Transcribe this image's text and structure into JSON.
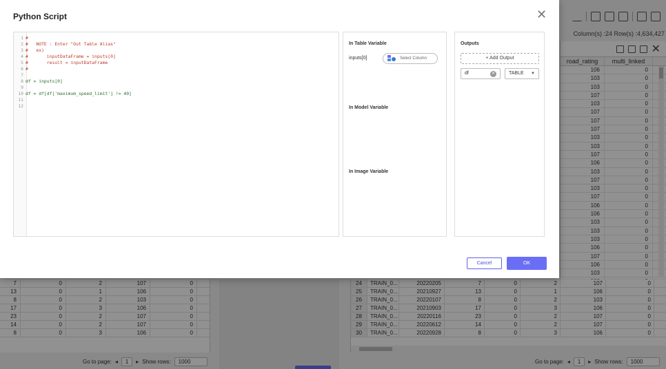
{
  "modal": {
    "title": "Python Script",
    "close_glyph": "✕",
    "code_lines": [
      {
        "n": "1",
        "text": "#",
        "kind": "comment"
      },
      {
        "n": "2",
        "text": "#   NOTE : Enter \"Out Table Alias\"",
        "kind": "comment"
      },
      {
        "n": "3",
        "text": "#   ex)",
        "kind": "comment"
      },
      {
        "n": "4",
        "text": "#       inputDataFrame = inputs[0]",
        "kind": "comment"
      },
      {
        "n": "5",
        "text": "#       result = inputDataFrame",
        "kind": "comment"
      },
      {
        "n": "6",
        "text": "#",
        "kind": "comment"
      },
      {
        "n": "7",
        "text": "",
        "kind": "plain"
      },
      {
        "n": "8",
        "text": "df = inputs[0]",
        "kind": "plain"
      },
      {
        "n": "9",
        "text": "",
        "kind": "plain"
      },
      {
        "n": "10",
        "text": "df = df[df['maximum_speed_limit'] != 40]",
        "kind": "plain"
      },
      {
        "n": "11",
        "text": "",
        "kind": "plain"
      },
      {
        "n": "12",
        "text": "",
        "kind": "plain"
      }
    ],
    "in_table_title": "In Table Variable",
    "input_var_label": "inputs[0]",
    "select_column_label": "Select Column",
    "in_model_title": "In Model Variable",
    "in_image_title": "In Image Variable",
    "outputs_title": "Outputs",
    "add_output_label": "+ Add Output",
    "output_name_value": "df",
    "output_type_value": "TABLE",
    "cancel_label": "Cancel",
    "ok_label": "OK"
  },
  "background": {
    "columns_info": "Column(s) :24   Row(s) :4,634,427",
    "right_headers": [
      "road_rating",
      "multi_linked"
    ],
    "right_rows": [
      [
        "106",
        "0"
      ],
      [
        "103",
        "0"
      ],
      [
        "103",
        "0"
      ],
      [
        "107",
        "0"
      ],
      [
        "103",
        "0"
      ],
      [
        "107",
        "0"
      ],
      [
        "107",
        "0"
      ],
      [
        "107",
        "0"
      ],
      [
        "103",
        "0"
      ],
      [
        "103",
        "0"
      ],
      [
        "107",
        "0"
      ],
      [
        "106",
        "0"
      ],
      [
        "103",
        "0"
      ],
      [
        "107",
        "0"
      ],
      [
        "103",
        "0"
      ],
      [
        "107",
        "0"
      ],
      [
        "106",
        "0"
      ],
      [
        "106",
        "0"
      ],
      [
        "103",
        "0"
      ],
      [
        "103",
        "0"
      ],
      [
        "103",
        "0"
      ],
      [
        "106",
        "0"
      ],
      [
        "107",
        "0"
      ],
      [
        "106",
        "0"
      ],
      [
        "103",
        "0"
      ],
      [
        "106",
        "0"
      ],
      [
        "107",
        "0"
      ],
      [
        "107",
        "0"
      ],
      [
        "106",
        "0"
      ]
    ],
    "left_rows": [
      [
        "7",
        "0",
        "2",
        "107",
        "0"
      ],
      [
        "13",
        "0",
        "1",
        "106",
        "0"
      ],
      [
        "8",
        "0",
        "2",
        "103",
        "0"
      ],
      [
        "17",
        "0",
        "3",
        "106",
        "0"
      ],
      [
        "23",
        "0",
        "2",
        "107",
        "0"
      ],
      [
        "14",
        "0",
        "2",
        "107",
        "0"
      ],
      [
        "8",
        "0",
        "3",
        "106",
        "0"
      ]
    ],
    "bottom_rows": [
      [
        "24",
        "TRAIN_0...",
        "20220205",
        "7",
        "0",
        "2",
        "107",
        "0"
      ],
      [
        "25",
        "TRAIN_0...",
        "20210927",
        "13",
        "0",
        "1",
        "106",
        "0"
      ],
      [
        "26",
        "TRAIN_0...",
        "20220107",
        "8",
        "0",
        "2",
        "103",
        "0"
      ],
      [
        "27",
        "TRAIN_0...",
        "20210903",
        "17",
        "0",
        "3",
        "106",
        "0"
      ],
      [
        "28",
        "TRAIN_0...",
        "20220116",
        "23",
        "0",
        "2",
        "107",
        "0"
      ],
      [
        "29",
        "TRAIN_0...",
        "20220612",
        "14",
        "0",
        "2",
        "107",
        "0"
      ],
      [
        "30",
        "TRAIN_0...",
        "20220928",
        "8",
        "0",
        "3",
        "106",
        "0"
      ]
    ],
    "pager_left": {
      "go_label": "Go to page:",
      "page": "1",
      "rows_label": "Show rows:",
      "rows": "1000"
    },
    "pager_right": {
      "go_label": "Go to page:",
      "page": "1",
      "rows_label": "Show rows:",
      "rows": "1000"
    }
  },
  "colors": {
    "primary": "#6a6ef5",
    "overlay": "rgba(0,0,0,0.43)"
  }
}
